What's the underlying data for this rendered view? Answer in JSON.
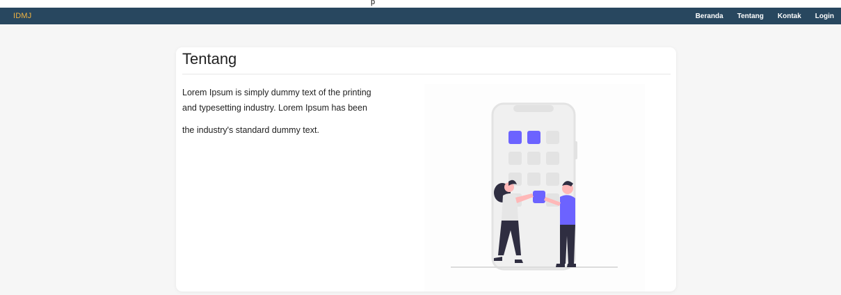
{
  "tooltip": "p",
  "navbar": {
    "brand": "IDMJ",
    "links": [
      "Beranda",
      "Tentang",
      "Kontak",
      "Login"
    ]
  },
  "card": {
    "title": "Tentang",
    "paragraph_lines": [
      "Lorem Ipsum is simply dummy text of the printing",
      "and typesetting industry. Lorem Ipsum has been",
      "the industry's standard dummy text."
    ]
  },
  "colors": {
    "navbar_bg": "#28475f",
    "brand": "#f2b441",
    "accent": "#6c63ff"
  },
  "illustration": {
    "name": "people-app-collaboration-illustration"
  }
}
